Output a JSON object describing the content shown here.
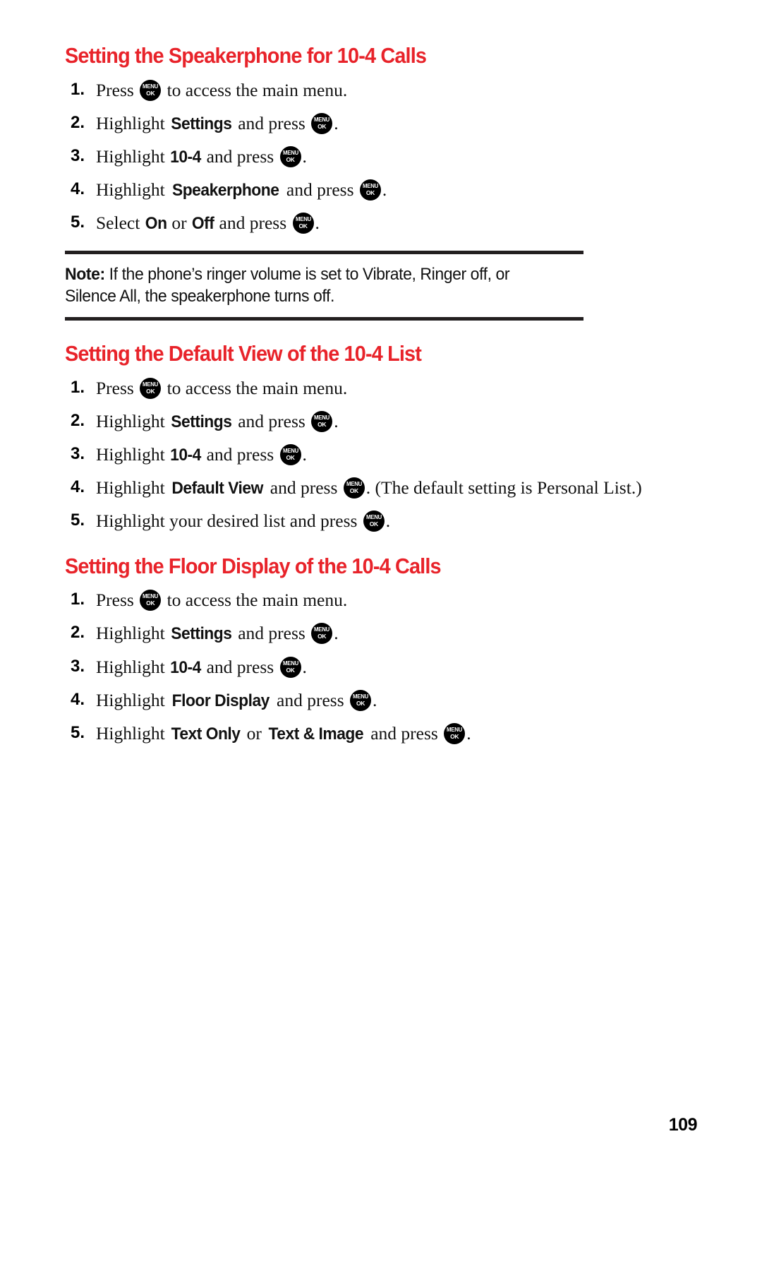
{
  "page": {
    "number": "109",
    "accent_color": "#e8232a",
    "text_color": "#111111",
    "background_color": "#ffffff"
  },
  "icons": {
    "menu_key": {
      "name": "menu-ok-key-icon",
      "top_label": "MENU",
      "bottom_label": "OK"
    }
  },
  "sections": [
    {
      "id": "speakerphone",
      "title": "Setting the Speakerphone for 10-4 Calls",
      "steps": [
        {
          "number": "1",
          "parts": [
            {
              "type": "text",
              "value": "Press "
            },
            {
              "type": "icon",
              "value": "menu-ok-key-icon"
            },
            {
              "type": "text",
              "value": " to access the main menu."
            }
          ]
        },
        {
          "number": "2",
          "parts": [
            {
              "type": "text",
              "value": "Highlight "
            },
            {
              "type": "term",
              "value": "Settings"
            },
            {
              "type": "text",
              "value": " and press "
            },
            {
              "type": "icon",
              "value": "menu-ok-key-icon"
            },
            {
              "type": "text",
              "value": "."
            }
          ]
        },
        {
          "number": "3",
          "parts": [
            {
              "type": "text",
              "value": "Highlight "
            },
            {
              "type": "term",
              "value": "10-4"
            },
            {
              "type": "text",
              "value": " and press "
            },
            {
              "type": "icon",
              "value": "menu-ok-key-icon"
            },
            {
              "type": "text",
              "value": "."
            }
          ]
        },
        {
          "number": "4",
          "parts": [
            {
              "type": "text",
              "value": "Highlight "
            },
            {
              "type": "term",
              "value": "Speakerphone"
            },
            {
              "type": "text",
              "value": " and press "
            },
            {
              "type": "icon",
              "value": "menu-ok-key-icon"
            },
            {
              "type": "text",
              "value": "."
            }
          ]
        },
        {
          "number": "5",
          "parts": [
            {
              "type": "text",
              "value": "Select "
            },
            {
              "type": "term",
              "value": "On"
            },
            {
              "type": "text",
              "value": " or "
            },
            {
              "type": "term",
              "value": "Off"
            },
            {
              "type": "text",
              "value": " and press "
            },
            {
              "type": "icon",
              "value": "menu-ok-key-icon"
            },
            {
              "type": "text",
              "value": "."
            }
          ]
        }
      ],
      "note": {
        "label": "Note:",
        "text": " If the phone’s ringer volume is set to Vibrate, Ringer off, or Silence All, the speakerphone turns off."
      }
    },
    {
      "id": "default-view",
      "title": "Setting the Default View of the 10-4 List",
      "steps": [
        {
          "number": "1",
          "parts": [
            {
              "type": "text",
              "value": "Press "
            },
            {
              "type": "icon",
              "value": "menu-ok-key-icon"
            },
            {
              "type": "text",
              "value": " to access the main menu."
            }
          ]
        },
        {
          "number": "2",
          "parts": [
            {
              "type": "text",
              "value": "Highlight "
            },
            {
              "type": "term",
              "value": "Settings"
            },
            {
              "type": "text",
              "value": " and press "
            },
            {
              "type": "icon",
              "value": "menu-ok-key-icon"
            },
            {
              "type": "text",
              "value": "."
            }
          ]
        },
        {
          "number": "3",
          "parts": [
            {
              "type": "text",
              "value": "Highlight "
            },
            {
              "type": "term",
              "value": "10-4"
            },
            {
              "type": "text",
              "value": " and press "
            },
            {
              "type": "icon",
              "value": "menu-ok-key-icon"
            },
            {
              "type": "text",
              "value": "."
            }
          ]
        },
        {
          "number": "4",
          "parts": [
            {
              "type": "text",
              "value": "Highlight "
            },
            {
              "type": "term",
              "value": "Default View"
            },
            {
              "type": "text",
              "value": " and press "
            },
            {
              "type": "icon",
              "value": "menu-ok-key-icon"
            },
            {
              "type": "text",
              "value": ". (The default setting is Personal List.)"
            }
          ]
        },
        {
          "number": "5",
          "parts": [
            {
              "type": "text",
              "value": "Highlight your desired list and press "
            },
            {
              "type": "icon",
              "value": "menu-ok-key-icon"
            },
            {
              "type": "text",
              "value": "."
            }
          ]
        }
      ]
    },
    {
      "id": "floor-display",
      "title": "Setting the Floor Display of the 10-4 Calls",
      "steps": [
        {
          "number": "1",
          "parts": [
            {
              "type": "text",
              "value": "Press "
            },
            {
              "type": "icon",
              "value": "menu-ok-key-icon"
            },
            {
              "type": "text",
              "value": " to access the main menu."
            }
          ]
        },
        {
          "number": "2",
          "parts": [
            {
              "type": "text",
              "value": "Highlight "
            },
            {
              "type": "term",
              "value": "Settings"
            },
            {
              "type": "text",
              "value": " and press "
            },
            {
              "type": "icon",
              "value": "menu-ok-key-icon"
            },
            {
              "type": "text",
              "value": "."
            }
          ]
        },
        {
          "number": "3",
          "parts": [
            {
              "type": "text",
              "value": "Highlight "
            },
            {
              "type": "term",
              "value": "10-4"
            },
            {
              "type": "text",
              "value": " and press "
            },
            {
              "type": "icon",
              "value": "menu-ok-key-icon"
            },
            {
              "type": "text",
              "value": "."
            }
          ]
        },
        {
          "number": "4",
          "parts": [
            {
              "type": "text",
              "value": "Highlight "
            },
            {
              "type": "term",
              "value": "Floor Display"
            },
            {
              "type": "text",
              "value": " and press "
            },
            {
              "type": "icon",
              "value": "menu-ok-key-icon"
            },
            {
              "type": "text",
              "value": "."
            }
          ]
        },
        {
          "number": "5",
          "parts": [
            {
              "type": "text",
              "value": "Highlight "
            },
            {
              "type": "term",
              "value": "Text Only"
            },
            {
              "type": "text",
              "value": " or "
            },
            {
              "type": "term",
              "value": "Text & Image"
            },
            {
              "type": "text",
              "value": " and press "
            },
            {
              "type": "icon",
              "value": "menu-ok-key-icon"
            },
            {
              "type": "text",
              "value": "."
            }
          ]
        }
      ]
    }
  ]
}
